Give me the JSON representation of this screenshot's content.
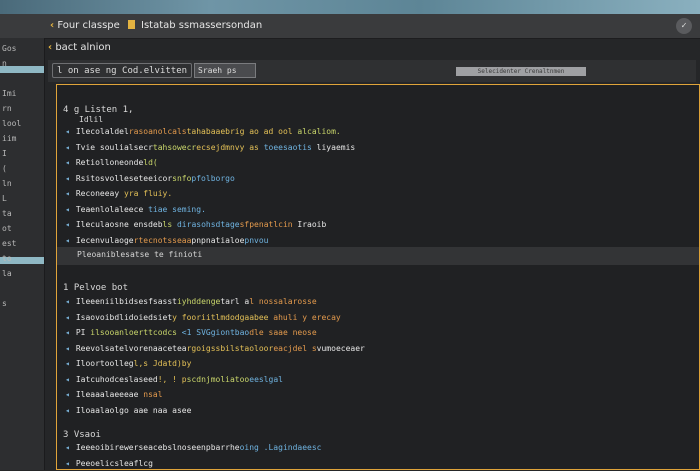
{
  "title_bar": {
    "tab1": "Four classpe",
    "tab2": "Istatab ssmassersondan",
    "window_control": "✓"
  },
  "sidebar": {
    "items": [
      "Gos",
      "n",
      "",
      "Imi",
      "rn",
      "lool",
      "iim",
      "I",
      "(",
      "ln",
      "L",
      "ta",
      "ot",
      "est",
      "to",
      "la",
      "",
      "s",
      "",
      "",
      "",
      "",
      "",
      "",
      ""
    ]
  },
  "breadcrumb": "bact alnion",
  "toolbar": {
    "group_label": "l on ase ng Cod.elvitten",
    "search": "Sraeh ps",
    "badge": "Selecidenter Crenaltnmen"
  },
  "section1": {
    "heading": "4  g  Listen 1,",
    "sub": "Idlil",
    "lines": [
      {
        "segs": [
          [
            "k",
            "Ilecolaldel"
          ],
          [
            "o",
            "rasoanolcals"
          ],
          [
            "y",
            "tahabaaebrig ao ad ool"
          ],
          [
            "g",
            " alcaliom."
          ]
        ]
      },
      {
        "segs": [
          [
            "k",
            "Tvie soulialsecr"
          ],
          [
            "g",
            "tahsowecr"
          ],
          [
            "y",
            "ecsejdmnvy as"
          ],
          [
            "b",
            " toeesaotis"
          ],
          [
            "k",
            " liyaemis"
          ]
        ]
      },
      {
        "segs": [
          [
            "k",
            "Retiolloneonde"
          ],
          [
            "g",
            "ld("
          ]
        ]
      },
      {
        "segs": [
          [
            "k",
            "Rsitosvolleseteeicor"
          ],
          [
            "g",
            "snfo"
          ],
          [
            "b",
            "pfolborgo"
          ]
        ]
      },
      {
        "segs": [
          [
            "k",
            "Reconeeay"
          ],
          [
            "y",
            " yra fluiy."
          ]
        ]
      },
      {
        "segs": [
          [
            "k",
            "Teaenlolaleece"
          ],
          [
            "b",
            " tiae seming."
          ]
        ]
      },
      {
        "segs": [
          [
            "k",
            "Ileculaosne ensdeb"
          ],
          [
            "g",
            "ls"
          ],
          [
            "b",
            " dirasohsdtage"
          ],
          [
            "o",
            "sfpenatlcin"
          ],
          [
            "k",
            " Iraoib"
          ]
        ]
      },
      {
        "segs": [
          [
            "k",
            "Iecenvulaoge"
          ],
          [
            "o",
            "rtecnotsseaa"
          ],
          [
            "k",
            "pnpnatialoe"
          ],
          [
            "b",
            "pnvou"
          ]
        ]
      }
    ],
    "status": "Pleoaniblesatse te finioti"
  },
  "section2": {
    "heading": "1  Pelvoe bot",
    "lines": [
      {
        "segs": [
          [
            "k",
            "Ileeeniilbidsesfsasst"
          ],
          [
            "g",
            "iyhddenge"
          ],
          [
            "k",
            "tarl a"
          ],
          [
            "o",
            "l   nossalarosse"
          ]
        ]
      },
      {
        "segs": [
          [
            "k",
            "Isaovoibdlidoiedsiet"
          ],
          [
            "y",
            "y fooriitlmdodgaabee"
          ],
          [
            "o",
            " ahuli y erecay"
          ]
        ]
      },
      {
        "segs": [
          [
            "k",
            "PI"
          ],
          [
            "g",
            "  ilsooanloerttcodcs"
          ],
          [
            "b",
            " <1 SVGgiontbao"
          ],
          [
            "o",
            "dle  saae neose"
          ]
        ]
      },
      {
        "segs": [
          [
            "k",
            "Reevolsatelvorenaacetea"
          ],
          [
            "y",
            "rgoigssbilstaoloor"
          ],
          [
            "o",
            "eacjdel s"
          ],
          [
            "k",
            "vumoeceaer"
          ]
        ]
      },
      {
        "segs": [
          [
            "k",
            "Iloortoolleg"
          ],
          [
            "y",
            "l,s Jdatd)by"
          ]
        ]
      },
      {
        "segs": [
          [
            "k",
            "Iatcuhodceslaseed"
          ],
          [
            "y",
            "!, ! p"
          ],
          [
            "g",
            "scdnjmoliatoo"
          ],
          [
            "b",
            "eeslgal"
          ]
        ]
      },
      {
        "segs": [
          [
            "k",
            "Ileaaalaeeeae"
          ],
          [
            "o",
            " nsal"
          ]
        ]
      },
      {
        "segs": [
          [
            "k",
            "Iloaalaolgo"
          ],
          [
            "k",
            " aae naa asee"
          ]
        ]
      }
    ]
  },
  "section3": {
    "heading": "3  Vsaoi",
    "lines": [
      {
        "segs": [
          [
            "k",
            "Ieeeoibirewerseacebslnoseenpbarrhe"
          ],
          [
            "b",
            "oing  .Lagindaeesc"
          ]
        ]
      },
      {
        "segs": [
          [
            "k",
            "Peeoelicsleaflcg"
          ]
        ]
      }
    ]
  }
}
